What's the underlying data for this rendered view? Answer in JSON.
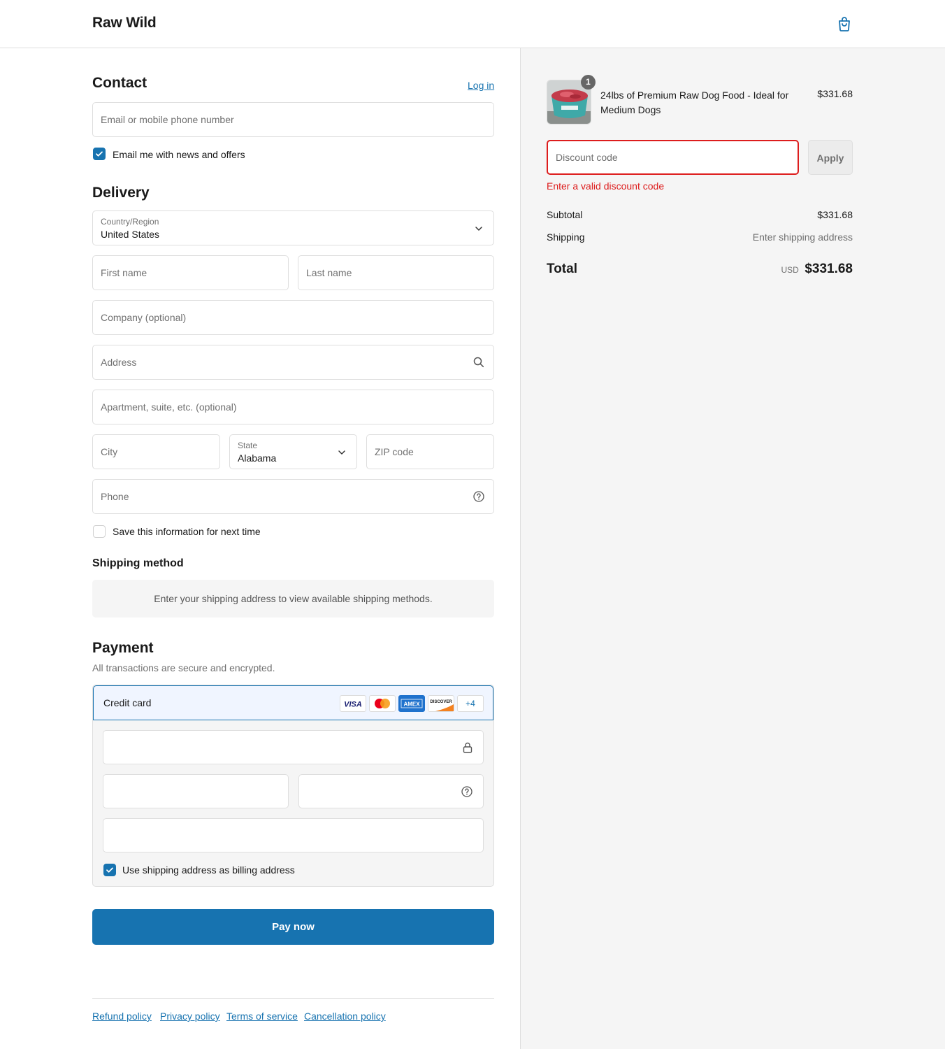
{
  "header": {
    "brand": "Raw Wild",
    "cart_icon": "shopping-bag-icon"
  },
  "contact": {
    "title": "Contact",
    "login_link": "Log in",
    "email_placeholder": "Email or mobile phone number",
    "newsletter_label": "Email me with news and offers",
    "newsletter_checked": true
  },
  "delivery": {
    "title": "Delivery",
    "country_label": "Country/Region",
    "country_value": "United States",
    "first_name_placeholder": "First name",
    "last_name_placeholder": "Last name",
    "company_placeholder": "Company (optional)",
    "address_placeholder": "Address",
    "apartment_placeholder": "Apartment, suite, etc. (optional)",
    "city_placeholder": "City",
    "state_label": "State",
    "state_value": "Alabama",
    "zip_placeholder": "ZIP code",
    "phone_placeholder": "Phone",
    "save_info_label": "Save this information for next time",
    "save_info_checked": false
  },
  "shipping_method": {
    "title": "Shipping method",
    "message": "Enter your shipping address to view available shipping methods."
  },
  "payment": {
    "title": "Payment",
    "subtitle": "All transactions are secure and encrypted.",
    "credit_card_label": "Credit card",
    "card_brands": [
      "VISA",
      "Mastercard",
      "AMEX",
      "DISCOVER"
    ],
    "more_cards": "+4",
    "billing_label": "Use shipping address as billing address",
    "billing_checked": true,
    "pay_button": "Pay now"
  },
  "footer": {
    "links": [
      "Refund policy",
      "Privacy policy",
      "Terms of service",
      "Cancellation policy"
    ]
  },
  "order_summary": {
    "item": {
      "name": "24lbs of Premium Raw Dog Food - Ideal for Medium Dogs",
      "price": "$331.68",
      "quantity": "1"
    },
    "discount_placeholder": "Discount code",
    "apply_button": "Apply",
    "discount_error": "Enter a valid discount code",
    "subtotal_label": "Subtotal",
    "subtotal_value": "$331.68",
    "shipping_label": "Shipping",
    "shipping_value": "Enter shipping address",
    "total_label": "Total",
    "currency": "USD",
    "total_value": "$331.68"
  },
  "colors": {
    "accent": "#1773b0",
    "error": "#dd1d1d",
    "summary_bg": "#f5f5f5"
  }
}
